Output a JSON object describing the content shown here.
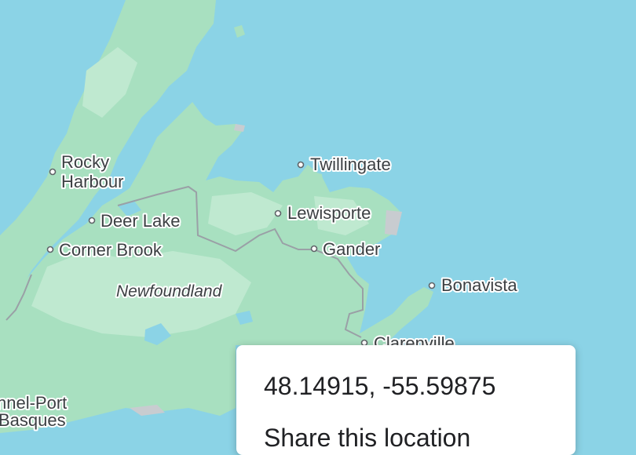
{
  "map": {
    "region_label": "Newfoundland",
    "places": [
      {
        "line1": "Rocky",
        "line2": "Harbour"
      },
      {
        "line1": "Deer Lake"
      },
      {
        "line1": "Corner Brook"
      },
      {
        "line1": "Twillingate"
      },
      {
        "line1": "Lewisporte"
      },
      {
        "line1": "Gander"
      },
      {
        "line1": "Bonavista"
      },
      {
        "line1": "Clarenville"
      },
      {
        "line1": "nnel-Port",
        "line2": "Basques"
      }
    ]
  },
  "popup": {
    "coordinates": "48.14915, -55.59875",
    "share_label": "Share this location"
  },
  "colors": {
    "water": "#8bd3e6",
    "land": "#a8e0c0",
    "forest": "#bfe9d0",
    "boundary": "#9aa0a6"
  }
}
